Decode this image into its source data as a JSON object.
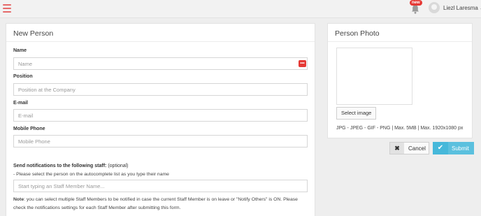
{
  "header": {
    "new_badge": "new",
    "user_name": "Liezl Laresma",
    "user_caret": "⌄",
    "icons": [
      "hamburger-menu-icon",
      "bell-icon",
      "avatar",
      "chevron-down-icon"
    ],
    "accent_color": "#e66a6a"
  },
  "form": {
    "title": "New Person",
    "name_label": "Name",
    "name_placeholder": "Name",
    "name_value": "",
    "position_label": "Position",
    "position_placeholder": "Position at the Company",
    "email_label": "E-mail",
    "email_placeholder": "E-mail",
    "phone_label": "Mobile Phone",
    "phone_placeholder": "Mobile Phone",
    "notify_title_bold": "Send notifications to the following staff:",
    "notify_title_rest": " (optional)",
    "notify_hint": "- Please select the person on the autocomplete list as you type their name",
    "staff_placeholder": "Start typing an Staff Member Name...",
    "note_bold": "Note",
    "note_text": ": you can select multiple Staff Members to be notified in case the current Staff Member is on leave or \"Notify Others\" is ON. Please check the notifications settings for each Staff Member after submitting this form."
  },
  "photo": {
    "title": "Person Photo",
    "select_label": "Select image",
    "hint": "JPG - JPEG - GIF - PNG | Max. 5MB | Max. 1920x1080 px"
  },
  "actions": {
    "cancel_label": "Cancel",
    "cancel_icon": "✖",
    "submit_label": "Submit",
    "submit_icon": "✔",
    "submit_color": "#5bc0de"
  },
  "password_manager_icon": "•••"
}
